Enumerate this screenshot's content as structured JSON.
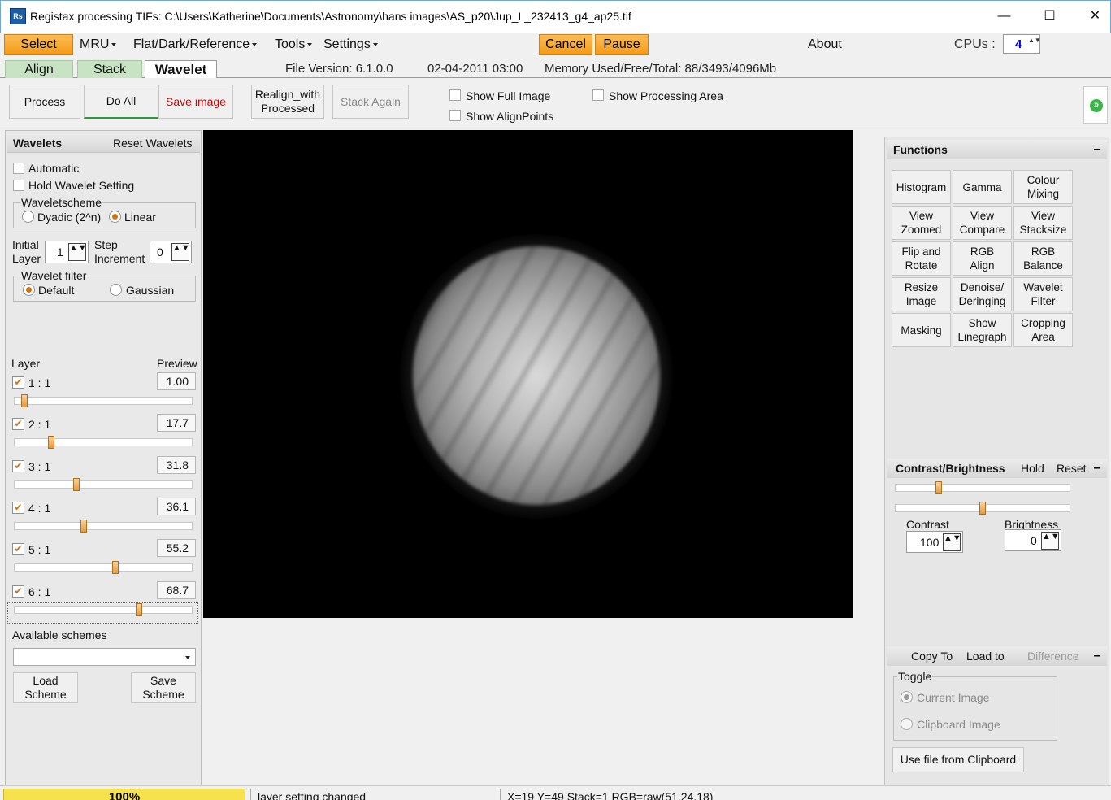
{
  "window": {
    "title": "Registax processing TIFs: C:\\Users\\Katherine\\Documents\\Astronomy\\hans images\\AS_p20\\Jup_L_232413_g4_ap25.tif",
    "icon_text": "Rs",
    "minimize": "—",
    "maximize": "☐",
    "close": "✕"
  },
  "menubar": {
    "select": "Select",
    "mru": "MRU",
    "flat_dark": "Flat/Dark/Reference",
    "tools": "Tools",
    "settings": "Settings",
    "cancel": "Cancel",
    "pause": "Pause",
    "about": "About",
    "cpus_label": "CPUs :",
    "cpus_value": "4",
    "spin_arrows": "▲▼"
  },
  "tabs": [
    {
      "label": "Align"
    },
    {
      "label": "Stack"
    },
    {
      "label": "Wavelet"
    }
  ],
  "info": {
    "file_version": "File Version: 6.1.0.0",
    "datetime": "02-04-2011 03:00",
    "memory": "Memory Used/Free/Total: 88/3493/4096Mb"
  },
  "toolbar": {
    "process": "Process",
    "do_all": "Do All",
    "save_image": "Save image",
    "realign": "Realign_with\nProcessed",
    "stack_again": "Stack Again",
    "show_full_image": "Show Full Image",
    "show_alignpoints": "Show AlignPoints",
    "show_processing_area": "Show Processing Area",
    "expand_icon": "»"
  },
  "wavelets": {
    "header": "Wavelets",
    "reset": "Reset Wavelets",
    "automatic": "Automatic",
    "hold": "Hold Wavelet Setting",
    "scheme_title": "Waveletscheme",
    "dyadic": "Dyadic (2^n)",
    "linear": "Linear",
    "initial_layer_label": "Initial\nLayer",
    "initial_layer_value": "1",
    "step_label": "Step\nIncrement",
    "step_value": "0",
    "filter_title": "Wavelet filter",
    "default": "Default",
    "gaussian": "Gaussian",
    "layer_header": "Layer",
    "preview_header": "Preview",
    "spin_arrows": "▲▼",
    "layers": [
      {
        "label": "1 : 1",
        "value": "1.00",
        "slider": 0.06
      },
      {
        "label": "2 : 1",
        "value": "17.7",
        "slider": 0.21
      },
      {
        "label": "3 : 1",
        "value": "31.8",
        "slider": 0.35
      },
      {
        "label": "4 : 1",
        "value": "36.1",
        "slider": 0.39
      },
      {
        "label": "5 : 1",
        "value": "55.2",
        "slider": 0.57
      },
      {
        "label": "6 : 1",
        "value": "68.7",
        "slider": 0.7
      }
    ],
    "available_schemes": "Available schemes",
    "load_scheme": "Load\nScheme",
    "save_scheme": "Save\nScheme"
  },
  "functions": {
    "header": "Functions",
    "collapse": "–",
    "buttons": [
      "Histogram",
      "Gamma",
      "Colour\nMixing",
      "View\nZoomed",
      "View\nCompare",
      "View\nStacksize",
      "Flip and\nRotate",
      "RGB\nAlign",
      "RGB\nBalance",
      "Resize\nImage",
      "Denoise/\nDeringing",
      "Wavelet\nFilter",
      "Masking",
      "Show\nLinegraph",
      "Cropping\nArea"
    ]
  },
  "contrast": {
    "header": "Contrast/Brightness",
    "hold": "Hold",
    "reset": "Reset",
    "collapse": "–",
    "contrast_label": "Contrast",
    "contrast_value": "100",
    "brightness_label": "Brightness",
    "brightness_value": "0",
    "contrast_slider": 0.25,
    "brightness_slider": 0.5
  },
  "copy": {
    "copy_to": "Copy To",
    "load_to": "Load to",
    "difference": "Difference",
    "collapse": "–",
    "toggle": "Toggle",
    "current_image": "Current Image",
    "clipboard_image": "Clipboard Image",
    "use_clipboard": "Use file from Clipboard"
  },
  "statusbar": {
    "progress": "100%",
    "message": "layer setting changed",
    "coords": "X=19 Y=49 Stack=1 RGB=raw(51,24,18)"
  }
}
